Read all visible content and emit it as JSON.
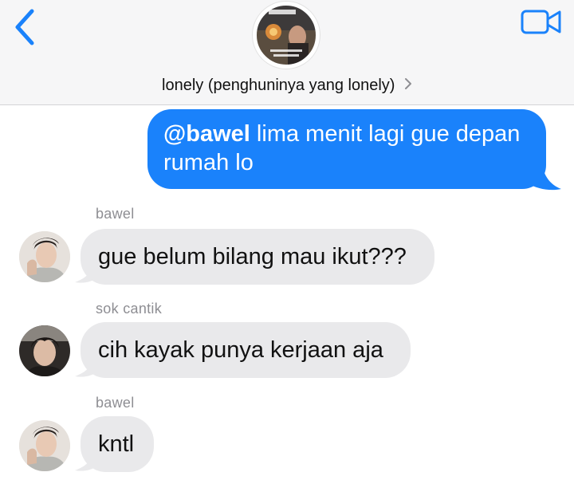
{
  "header": {
    "group_name": "lonely (penghuninya yang lonely)",
    "back_icon": "chevron-left-icon",
    "video_icon": "video-camera-icon",
    "detail_icon": "chevron-right-icon"
  },
  "messages": [
    {
      "direction": "outgoing",
      "mention": "@bawel",
      "text": " lima menit lagi gue depan rumah lo"
    },
    {
      "direction": "incoming",
      "sender": "bawel",
      "text": "gue belum bilang mau ikut???"
    },
    {
      "direction": "incoming",
      "sender": "sok cantik",
      "text": "cih kayak punya kerjaan aja"
    },
    {
      "direction": "incoming",
      "sender": "bawel",
      "text": "kntl"
    }
  ],
  "colors": {
    "accent": "#1a82fb",
    "incoming_bubble": "#e9e9eb",
    "header_bg": "#f6f6f7",
    "sender_text": "#8e8e93"
  }
}
